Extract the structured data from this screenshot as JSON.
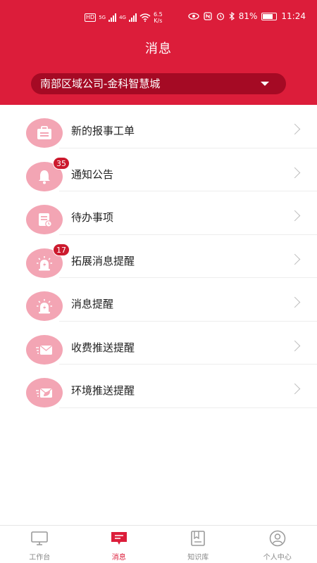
{
  "statusbar": {
    "network_5g": "5G",
    "network_4g": "4G",
    "hd_label": "HD",
    "speed_value": "6.5",
    "speed_unit": "K/s",
    "battery": "81%",
    "time": "11:24"
  },
  "header": {
    "title": "消息",
    "org_select_value": "南部区域公司-金科智慧城"
  },
  "list": [
    {
      "label": "新的报事工单",
      "icon": "briefcase-icon",
      "badge": ""
    },
    {
      "label": "通知公告",
      "icon": "bell-icon",
      "badge": "35"
    },
    {
      "label": "待办事项",
      "icon": "document-clock-icon",
      "badge": ""
    },
    {
      "label": "拓展消息提醒",
      "icon": "alarm-light-icon",
      "badge": "17"
    },
    {
      "label": "消息提醒",
      "icon": "alarm-light-icon",
      "badge": ""
    },
    {
      "label": "收费推送提醒",
      "icon": "envelope-icon",
      "badge": ""
    },
    {
      "label": "环境推送提醒",
      "icon": "envelope-leaf-icon",
      "badge": ""
    }
  ],
  "tabbar": [
    {
      "label": "工作台",
      "icon": "monitor-icon",
      "active": false
    },
    {
      "label": "消息",
      "icon": "message-icon",
      "active": true
    },
    {
      "label": "知识库",
      "icon": "book-icon",
      "active": false
    },
    {
      "label": "个人中心",
      "icon": "user-icon",
      "active": false
    }
  ],
  "colors": {
    "primary": "#dc1d3a",
    "select_bg": "#a50a24",
    "icon_bg": "#f3a5b4",
    "badge": "#cc1a2e"
  }
}
